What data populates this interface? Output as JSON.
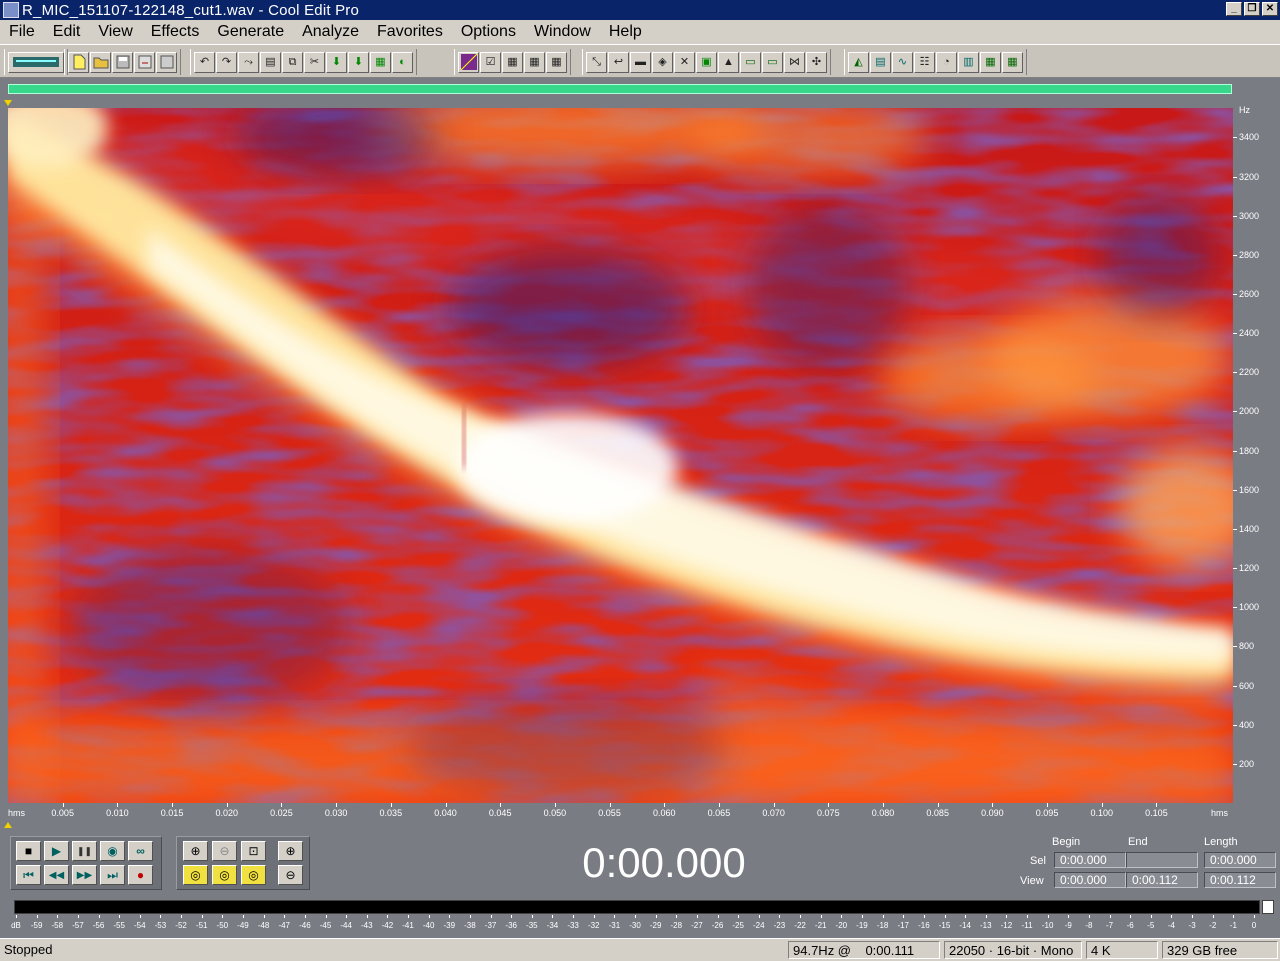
{
  "window": {
    "title": "R_MIC_151107-122148_cut1.wav - Cool Edit Pro",
    "minimize": "_",
    "restore": "❐",
    "close": "✕"
  },
  "menu": [
    "File",
    "Edit",
    "View",
    "Effects",
    "Generate",
    "Analyze",
    "Favorites",
    "Options",
    "Window",
    "Help"
  ],
  "spectrogram": {
    "freq_unit": "Hz",
    "freq_ticks": [
      "3400",
      "3200",
      "3000",
      "2800",
      "2600",
      "2400",
      "2200",
      "2000",
      "1800",
      "1600",
      "1400",
      "1200",
      "1000",
      "800",
      "600",
      "400",
      "200"
    ],
    "freq_min": 0,
    "freq_max": 3550,
    "time_unit": "hms",
    "time_ticks": [
      "0.005",
      "0.010",
      "0.015",
      "0.020",
      "0.025",
      "0.030",
      "0.035",
      "0.040",
      "0.045",
      "0.050",
      "0.055",
      "0.060",
      "0.065",
      "0.070",
      "0.075",
      "0.080",
      "0.085",
      "0.090",
      "0.095",
      "0.100",
      "0.105"
    ],
    "time_max": 0.112
  },
  "transport": {
    "time_display": "0:00.000",
    "stop": "■",
    "play": "▶",
    "pause": "❚❚",
    "play_to_end": "◉",
    "loop": "∞",
    "go_begin": "⏮",
    "rewind": "◀◀",
    "fast_forward": "▶▶",
    "go_end": "⏭",
    "record": "●"
  },
  "zoom": {
    "zoom_in": "⊕",
    "zoom_out": "⊖",
    "zoom_full": "⊡",
    "zoom_in_v": "⊕",
    "zoom_left": "◎",
    "zoom_right": "◎",
    "zoom_sel": "◎",
    "zoom_out_v": "⊖"
  },
  "selection": {
    "begin_label": "Begin",
    "end_label": "End",
    "length_label": "Length",
    "sel_label": "Sel",
    "view_label": "View",
    "sel_begin": "0:00.000",
    "sel_end": "",
    "sel_length": "0:00.000",
    "view_begin": "0:00.000",
    "view_end": "0:00.112",
    "view_length": "0:00.112"
  },
  "level_meter": {
    "labels": [
      "dB",
      "-59",
      "-58",
      "-57",
      "-56",
      "-55",
      "-54",
      "-53",
      "-52",
      "-51",
      "-50",
      "-49",
      "-48",
      "-47",
      "-46",
      "-45",
      "-44",
      "-43",
      "-42",
      "-41",
      "-40",
      "-39",
      "-38",
      "-37",
      "-36",
      "-35",
      "-34",
      "-33",
      "-32",
      "-31",
      "-30",
      "-29",
      "-28",
      "-27",
      "-26",
      "-25",
      "-24",
      "-23",
      "-22",
      "-21",
      "-20",
      "-19",
      "-18",
      "-17",
      "-16",
      "-15",
      "-14",
      "-13",
      "-12",
      "-11",
      "-10",
      "-9",
      "-8",
      "-7",
      "-6",
      "-5",
      "-4",
      "-3",
      "-2",
      "-1",
      "0"
    ]
  },
  "status": {
    "state": "Stopped",
    "cursor_info": "94.7Hz @    0:00.111",
    "format": "22050 · 16-bit · Mono",
    "size": "4 K",
    "free": "329 GB free"
  },
  "colors": {
    "spectrogram_low": "#3a1a6e",
    "spectrogram_mid": "#e02010",
    "spectrogram_high": "#fff8d0",
    "overview_bar": "#38d88c"
  }
}
